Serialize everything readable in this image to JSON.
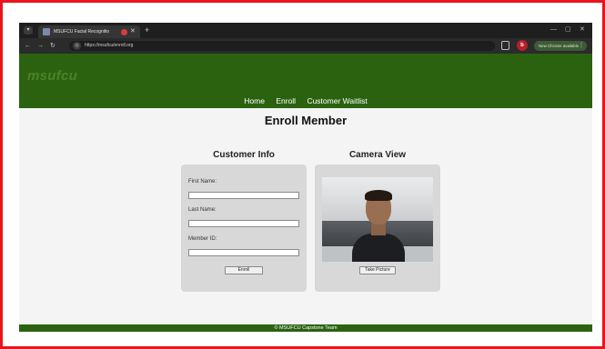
{
  "browser": {
    "tab_title": "MSUFCU Facial Recognitio",
    "tab_close": "✕",
    "new_tab": "+",
    "url": "https://msufcu/enroll.org",
    "update_label": "New Chrome available",
    "profile_initial": "b"
  },
  "site": {
    "logo": "msufcu",
    "nav": [
      "Home",
      "Enroll",
      "Customer Waitlist"
    ],
    "page_title": "Enroll Member",
    "footer": "© MSUFCU Capstone Team"
  },
  "customer_info": {
    "heading": "Customer Info",
    "first_name_label": "First Name:",
    "first_name_value": "",
    "last_name_label": "Last Name:",
    "last_name_value": "",
    "member_id_label": "Member ID:",
    "member_id_value": "",
    "enroll_button": "Enroll"
  },
  "camera": {
    "heading": "Camera View",
    "take_picture_button": "Take Picture"
  },
  "colors": {
    "brand_green": "#2b6210",
    "frame_border": "#e8141c"
  }
}
